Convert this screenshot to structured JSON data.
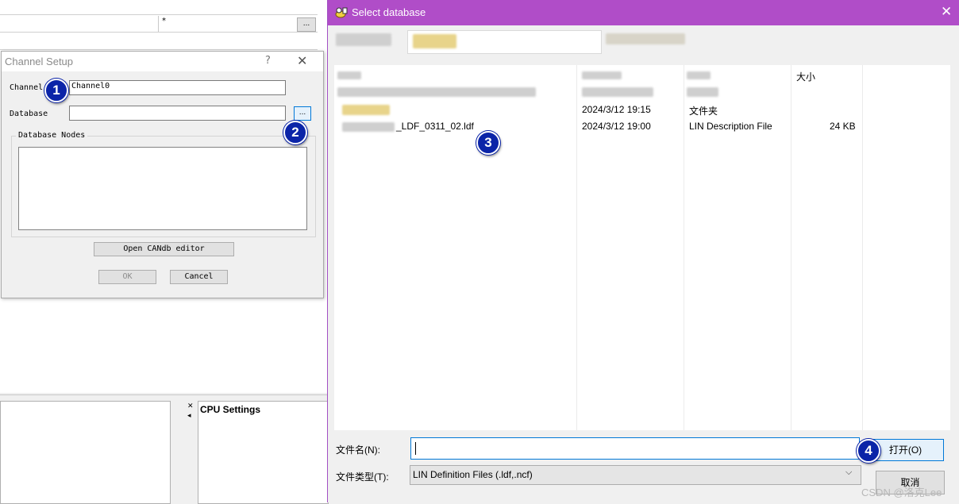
{
  "background_app": {
    "row_value": "*",
    "browse_label": "...",
    "cpu_pane_title": "CPU Settings"
  },
  "channel_dialog": {
    "title": "Channel Setup",
    "help_glyph": "?",
    "close_glyph": "✕",
    "channel_label": "Channel",
    "channel_value": "Channel0",
    "database_label": "Database",
    "database_value": "",
    "browse_label": "...",
    "nodes_group_label": "Database Nodes",
    "open_editor_label": "Open CANdb editor",
    "ok_label": "OK",
    "cancel_label": "Cancel"
  },
  "file_dialog": {
    "title": "Select database",
    "close_glyph": "✕",
    "columns": {
      "size": "大小"
    },
    "rows": [
      {
        "name": "",
        "date": "2024/3/12 19:15",
        "type": "文件夹",
        "size": ""
      },
      {
        "name": "_LDF_0311_02.ldf",
        "date": "2024/3/12 19:00",
        "type": "LIN Description File",
        "size": "24 KB"
      }
    ],
    "filename_label": "文件名(N):",
    "filename_value": "",
    "filetype_label": "文件类型(T):",
    "filetype_value": "LIN Definition Files (.ldf,.ncf)",
    "open_label": "打开(O)",
    "cancel_label": "取消"
  },
  "annotations": [
    "1",
    "2",
    "3",
    "4"
  ],
  "watermark": "CSDN @洛克Lee",
  "colors": {
    "title_bar": "#b04dc8",
    "accent": "#0078d7",
    "badge": "#0b24a8"
  }
}
